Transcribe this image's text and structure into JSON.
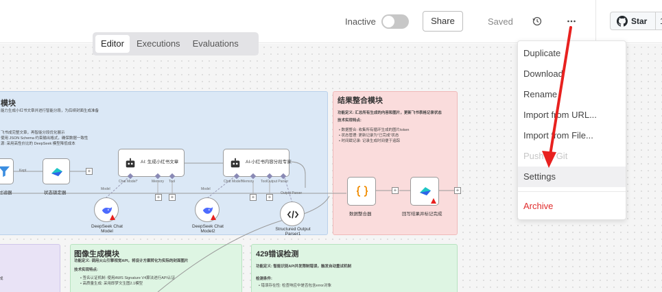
{
  "header": {
    "inactive_label": "Inactive",
    "share_label": "Share",
    "saved_label": "Saved",
    "star_label": "Star",
    "star_count": "1"
  },
  "tabs": [
    {
      "label": "Editor",
      "active": true
    },
    {
      "label": "Executions",
      "active": false
    },
    {
      "label": "Evaluations",
      "active": false
    }
  ],
  "menu": {
    "items": [
      {
        "label": "Duplicate",
        "state": "normal"
      },
      {
        "label": "Download",
        "state": "normal"
      },
      {
        "label": "Rename",
        "state": "normal"
      },
      {
        "label": "Import from URL...",
        "state": "normal"
      },
      {
        "label": "Import from File...",
        "state": "normal"
      },
      {
        "label": "Push to Git",
        "state": "disabled"
      },
      {
        "label": "Settings",
        "state": "hover"
      },
      {
        "label": "Archive",
        "state": "danger"
      }
    ]
  },
  "notes": {
    "content_module": {
      "title": "模块",
      "lines": [
        "能力生成小红书文章并进行智能分段，为后续封面生成准备",
        "",
        "飞书成完整文章，再智能分段优化展示",
        "使用 JSON Schema 约束输出格式，确保数据一致性",
        "源: 采用高性价比的 DeepSeek 模型降低成本"
      ],
      "color": "#dbe8f6",
      "border": "#b9d0ea"
    },
    "result_module": {
      "title": "结果整合模块",
      "lines": [
        "功能定义: 汇总所有生成的内容和图片，更新飞书表格记录状态",
        "技术实现特点:",
        "• 数据整合: 收集所有循环生成的图片token",
        "• 状态管理: 更新记录为\"已完成\"状态",
        "• 时间戳记录: 记录生成时间便于追踪"
      ],
      "color": "#fadcdc",
      "border": "#efb9b9"
    },
    "image_module": {
      "title": "图像生成模块",
      "lines": [
        "功能定义: 调用火山引擎视觉API，将设计方案转化为实际的封面图片",
        "技术实现特点:",
        "• 签名认证机制: 使用AWS Signature V4算法进行API认证",
        "• 高质量生成: 采用即梦文生图2.1模型"
      ],
      "color": "#def5e3",
      "border": "#b7e2c0"
    },
    "error_module": {
      "title": "429错误检测",
      "lines": [
        "功能定义: 智能识别API并发限制错误，触发自动重试机制",
        "",
        "检测条件:",
        "• 错误存在性: 检查响应中是否包含error对象"
      ],
      "color": "#def5e3",
      "border": "#b7e2c0"
    },
    "left_purple": {
      "lines": [
        "成"
      ],
      "color": "#e9e3f6",
      "border": "#d0c6ea"
    }
  },
  "nodes": {
    "filter": {
      "label": "过滤器"
    },
    "status_lock": {
      "label": "状态锁定器"
    },
    "ai_gen": {
      "label": "AI: 生成小红书文章"
    },
    "ai_split": {
      "label": "AI-小红书内容分段专家"
    },
    "deepseek1": {
      "label": "DeepSeek Chat Model"
    },
    "deepseek2": {
      "label": "DeepSeek Chat Model2"
    },
    "structured": {
      "label": "Structured Output Parser1"
    },
    "data_merge": {
      "label": "数据整合器"
    },
    "write_back": {
      "label": "回写结果并标记完成"
    }
  },
  "ports": {
    "model": "Model",
    "chat_model": "Chat Model*",
    "memory": "Memory",
    "tool": "Tool",
    "output_parser": "Output Parser",
    "kept": "Kept"
  },
  "colors": {
    "accent_red": "#e8211f",
    "menu_danger": "#e02b2b"
  }
}
